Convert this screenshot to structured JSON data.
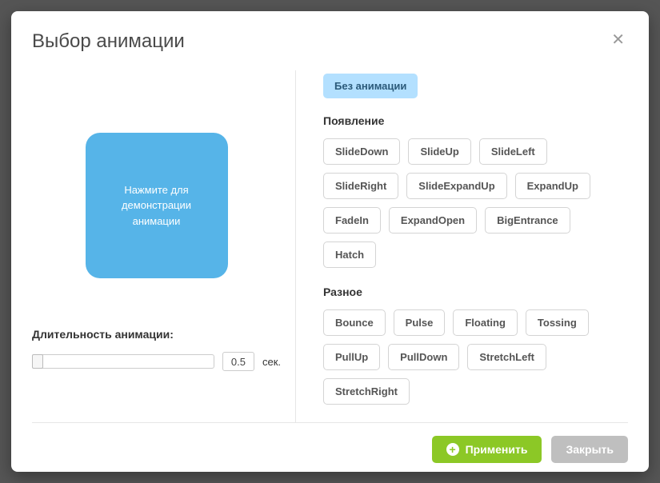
{
  "modal": {
    "title": "Выбор анимации"
  },
  "preview": {
    "text": "Нажмите для демонстрации анимации"
  },
  "duration": {
    "label": "Длительность анимации:",
    "value": "0.5",
    "unit": "сек."
  },
  "no_animation_label": "Без анимации",
  "groups": {
    "appearance": {
      "title": "Появление",
      "items": [
        "SlideDown",
        "SlideUp",
        "SlideLeft",
        "SlideRight",
        "SlideExpandUp",
        "ExpandUp",
        "FadeIn",
        "ExpandOpen",
        "BigEntrance",
        "Hatch"
      ]
    },
    "misc": {
      "title": "Разное",
      "items": [
        "Bounce",
        "Pulse",
        "Floating",
        "Tossing",
        "PullUp",
        "PullDown",
        "StretchLeft",
        "StretchRight"
      ]
    }
  },
  "footer": {
    "apply": "Применить",
    "close": "Закрыть"
  }
}
